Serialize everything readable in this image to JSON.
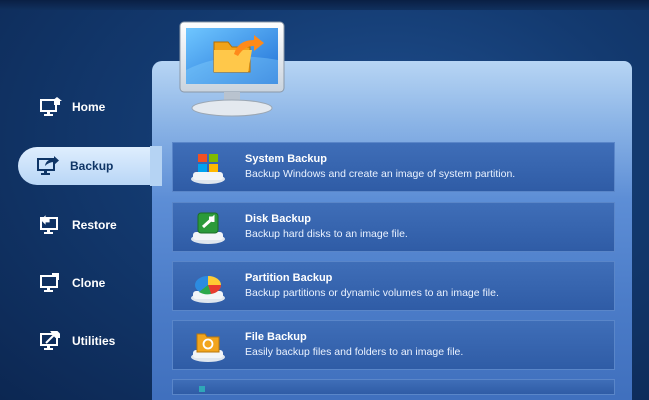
{
  "sidebar": {
    "items": [
      {
        "label": "Home",
        "icon": "home-icon"
      },
      {
        "label": "Backup",
        "icon": "backup-icon",
        "active": true
      },
      {
        "label": "Restore",
        "icon": "restore-icon"
      },
      {
        "label": "Clone",
        "icon": "clone-icon"
      },
      {
        "label": "Utilities",
        "icon": "utilities-icon"
      }
    ]
  },
  "main": {
    "options": [
      {
        "title": "System Backup",
        "description": "Backup Windows and create an image of system partition.",
        "icon": "windows-logo-icon"
      },
      {
        "title": "Disk Backup",
        "description": "Backup hard disks to an image file.",
        "icon": "disk-icon"
      },
      {
        "title": "Partition Backup",
        "description": "Backup partitions or dynamic volumes to an image file.",
        "icon": "partition-pie-icon"
      },
      {
        "title": "File Backup",
        "description": "Easily backup files and folders to an image file.",
        "icon": "folder-icon"
      }
    ]
  },
  "colors": {
    "accent": "#b9d6f6",
    "row_bg": "#3a69b3",
    "background": "#133a70"
  }
}
